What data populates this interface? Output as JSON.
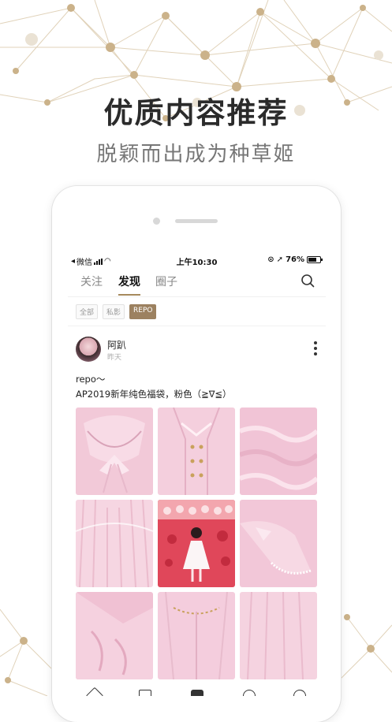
{
  "promo": {
    "headline": "优质内容推荐",
    "subline": "脱颖而出成为种草姬"
  },
  "statusbar": {
    "carrier": "微信",
    "time": "上午10:30",
    "battery": "76%"
  },
  "tabs": [
    {
      "label": "关注",
      "active": false
    },
    {
      "label": "发现",
      "active": true
    },
    {
      "label": "圈子",
      "active": false
    }
  ],
  "filters": [
    {
      "label": "全部",
      "selected": false
    },
    {
      "label": "私影",
      "selected": false
    },
    {
      "label": "REPO",
      "selected": true
    }
  ],
  "post": {
    "username": "阿趴",
    "time": "昨天",
    "text_line1": "repo～",
    "text_line2": "AP2019新年纯色福袋，粉色（≧∇≦）",
    "photos": [
      {
        "subject": "collar-bow",
        "color": "#f2c9d8"
      },
      {
        "subject": "dress-front-buttons",
        "color": "#f4cfdd"
      },
      {
        "subject": "ruffle-tiers",
        "color": "#f1c4d6"
      },
      {
        "subject": "skirt-gathers",
        "color": "#f6d6e2"
      },
      {
        "subject": "model-red-backdrop",
        "color": "#e0475a"
      },
      {
        "subject": "ruffled-sleeve",
        "color": "#f2c7d8"
      },
      {
        "subject": "cuff-ruffle",
        "color": "#f0c1d3"
      },
      {
        "subject": "bodice-back",
        "color": "#f4cddd"
      },
      {
        "subject": "skirt-hem",
        "color": "#f5d3e0"
      }
    ]
  },
  "icons": {
    "more": "more-vertical-icon",
    "search": "search-icon"
  },
  "colors": {
    "accent": "#a6895c",
    "chip_selected": "#9c8160"
  }
}
